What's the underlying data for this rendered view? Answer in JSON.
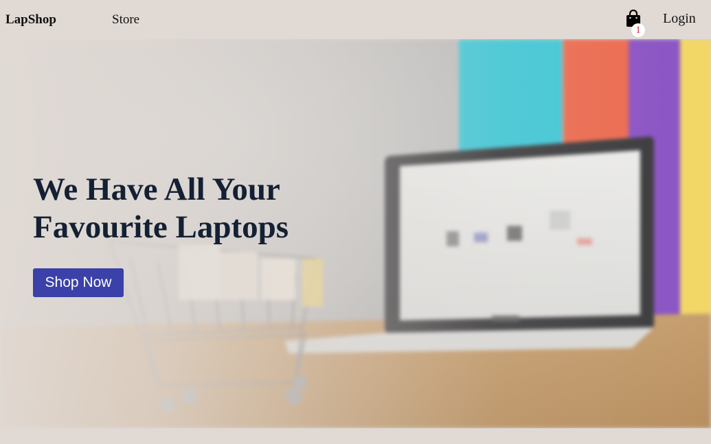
{
  "navbar": {
    "brand": "LapShop",
    "links": [
      {
        "label": "Store"
      }
    ],
    "cart": {
      "icon": "shopping-bag-icon",
      "count": "1"
    },
    "login_label": "Login"
  },
  "hero": {
    "title_line1": "We Have All Your",
    "title_line2": "Favourite Laptops",
    "cta_label": "Shop Now",
    "image": "laptop-and-shopping-cart-photo"
  },
  "colors": {
    "background": "#e0d9d4",
    "accent": "#3b41a8",
    "title": "#142033",
    "badge_text": "#d62839"
  }
}
